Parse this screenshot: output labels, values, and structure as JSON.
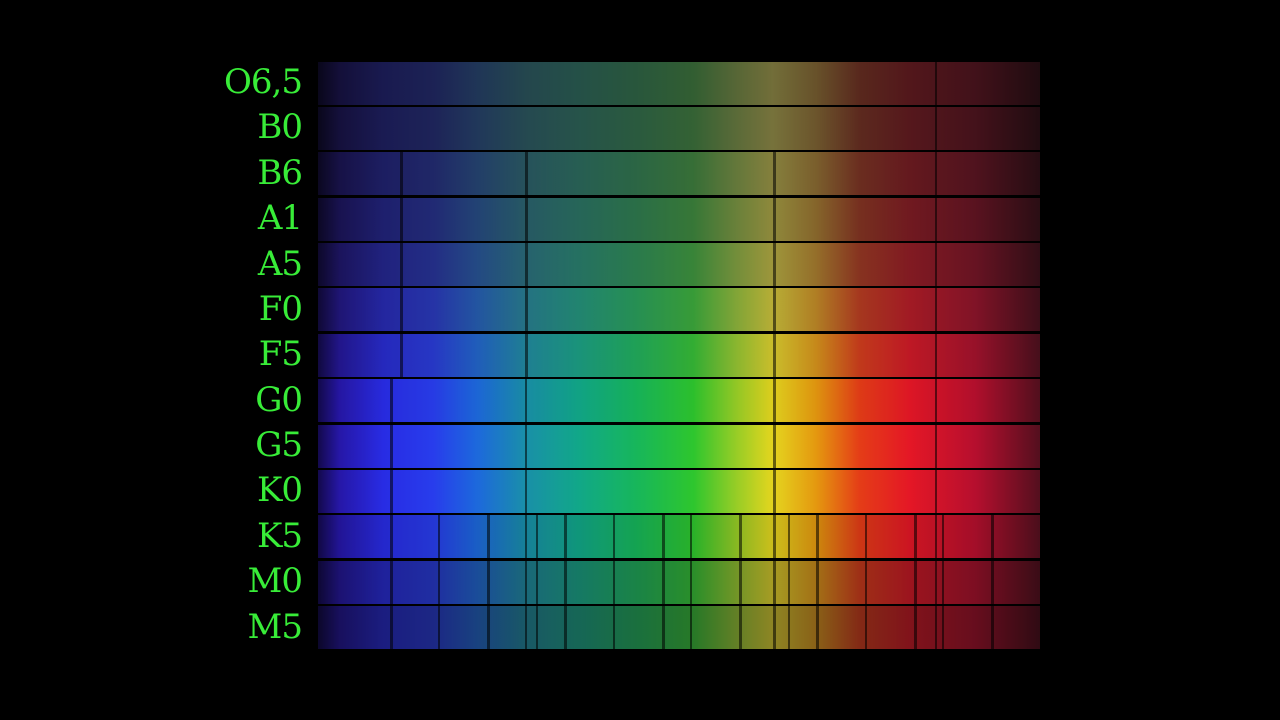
{
  "title": "Stellar spectral classes",
  "spectral_classes": [
    {
      "label": "O6,5",
      "brightness": 0.5,
      "saturation": 0.55
    },
    {
      "label": "B0",
      "brightness": 0.52,
      "saturation": 0.55
    },
    {
      "label": "B6",
      "brightness": 0.58,
      "saturation": 0.6
    },
    {
      "label": "A1",
      "brightness": 0.62,
      "saturation": 0.65
    },
    {
      "label": "A5",
      "brightness": 0.68,
      "saturation": 0.7
    },
    {
      "label": "F0",
      "brightness": 0.78,
      "saturation": 0.8
    },
    {
      "label": "F5",
      "brightness": 0.85,
      "saturation": 0.9
    },
    {
      "label": "G0",
      "brightness": 0.92,
      "saturation": 1.0
    },
    {
      "label": "G5",
      "brightness": 0.95,
      "saturation": 1.0
    },
    {
      "label": "K0",
      "brightness": 0.95,
      "saturation": 1.0
    },
    {
      "label": "K5",
      "brightness": 0.85,
      "saturation": 1.0
    },
    {
      "label": "M0",
      "brightness": 0.7,
      "saturation": 0.9
    },
    {
      "label": "M5",
      "brightness": 0.6,
      "saturation": 0.85
    }
  ],
  "label_color": "#38ec38"
}
